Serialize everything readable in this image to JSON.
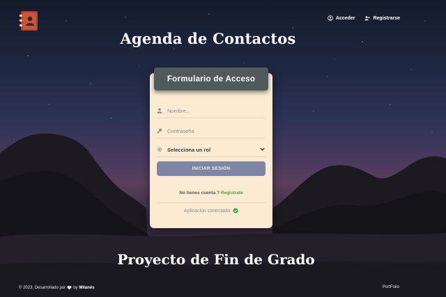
{
  "app": {
    "title": "Agenda de Contactos",
    "subtitle": "Proyecto de Fin de Grado",
    "logo_icon": "address-book-icon"
  },
  "nav": {
    "login_label": "Acceder",
    "login_icon": "user-circle-icon",
    "register_label": "Registrarse",
    "register_icon": "user-plus-icon"
  },
  "form": {
    "header": "Formulario de Acceso",
    "name_placeholder": "Nombre...",
    "name_icon": "user-icon",
    "password_placeholder": "Contraseña",
    "password_icon": "key-icon",
    "role_selected": "Selecciona un rol",
    "role_icon": "gear-icon",
    "submit_label": "INICIAR SESIÓN",
    "no_account_text": "No tienes cuenta ?",
    "register_link": "Registrate",
    "status_text": "Aplicación conectada",
    "status_icon": "check-circle-icon"
  },
  "footer": {
    "copyright_prefix": "© 2023, Desarrollado por",
    "by": "by",
    "author": "Milanés",
    "portfolio_link": "PortFolio"
  },
  "colors": {
    "card_bg": "#fbebd3",
    "header_bg": "#505a5c",
    "button_bg": "#7f86a3",
    "link_green": "#4f9a48",
    "status_green": "#2fa84f"
  }
}
